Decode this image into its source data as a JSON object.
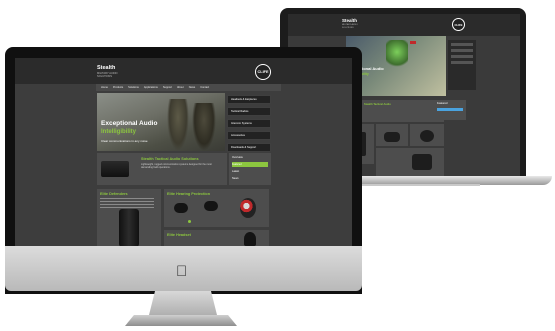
{
  "site": {
    "logo_name": "Stealth",
    "logo_tagline": "MILITARY AUDIO SOLUTIONS",
    "badge": "CLIFE",
    "nav": [
      "Home",
      "Products",
      "Solutions",
      "Applications",
      "Support",
      "About",
      "News",
      "Contact"
    ],
    "hero_line1": "Exceptional Audio",
    "hero_line2": "Intelligibility",
    "hero_line3": "Clear communications in any noise",
    "hero_menu": [
      "Headsets & Earpieces",
      "Tactical Radios",
      "Intercom Systems",
      "Accessories",
      "Downloads & Support"
    ],
    "feature_title": "Stealth Tactical Audio Solutions",
    "feature_text": "Lightweight, rugged communication systems designed for the most demanding field operations.",
    "sidebar_items": [
      "Overview",
      "Featured",
      "Latest",
      "News"
    ],
    "product_titles": [
      "Elite Defenders",
      "Elite Hearing Protection",
      "Elite Headset"
    ],
    "laptop_hero_line1": "Exceptional Audio",
    "laptop_hero_line2": "Intelligibility",
    "laptop_section_title": "Stealth Tactical Audio",
    "laptop_sidebar_title": "Featured"
  },
  "colors": {
    "accent": "#8cc63f",
    "panel": "#4d4d4d",
    "header": "#2b2b2b"
  },
  "icons": {
    "apple": "apple-logo"
  }
}
